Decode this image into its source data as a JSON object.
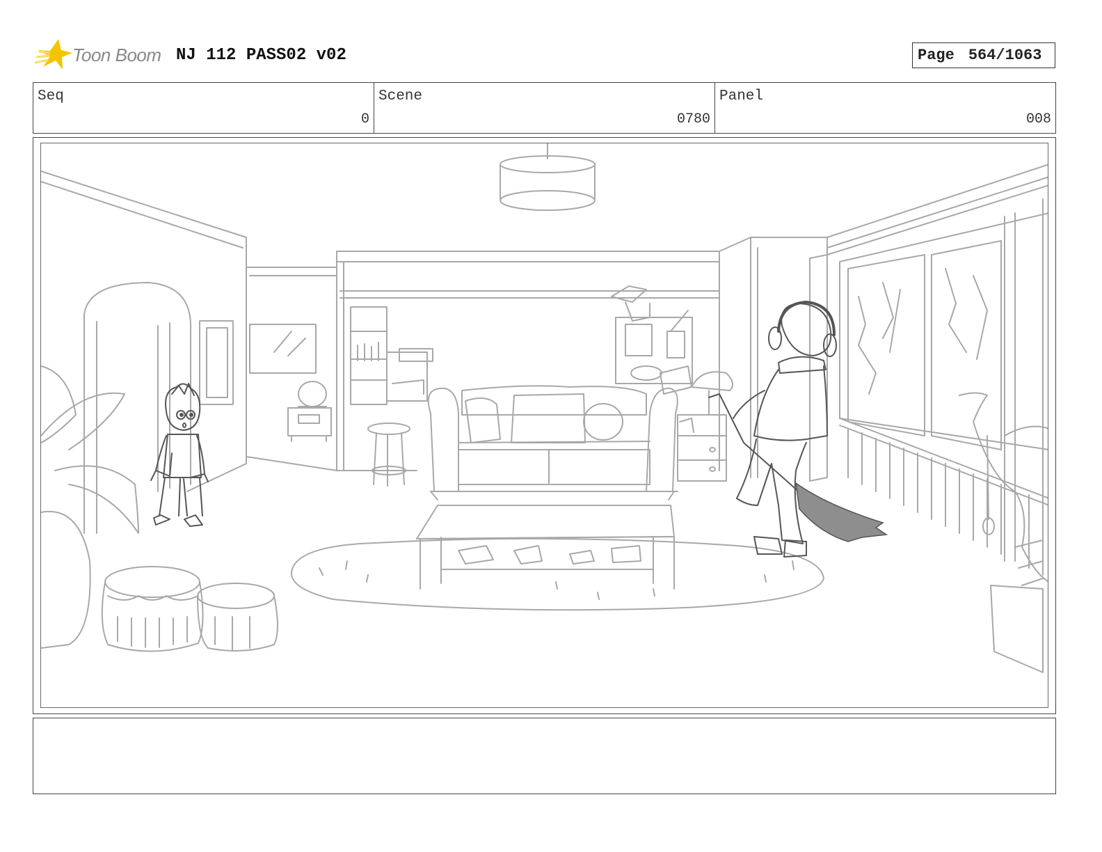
{
  "header": {
    "logo_text": "Toon Boom",
    "project_title": "NJ 112 PASS02 v02",
    "page_label": "Page",
    "page_value": "564/1063"
  },
  "info": {
    "seq_label": "Seq",
    "seq_value": "0",
    "scene_label": "Scene",
    "scene_value": "0780",
    "panel_label": "Panel",
    "panel_value": "008"
  },
  "colors": {
    "sketch_line": "#a8a8a8",
    "character_line": "#555555",
    "logo_star": "#f5c400"
  },
  "icons": [
    "toon-boom-star-icon"
  ]
}
